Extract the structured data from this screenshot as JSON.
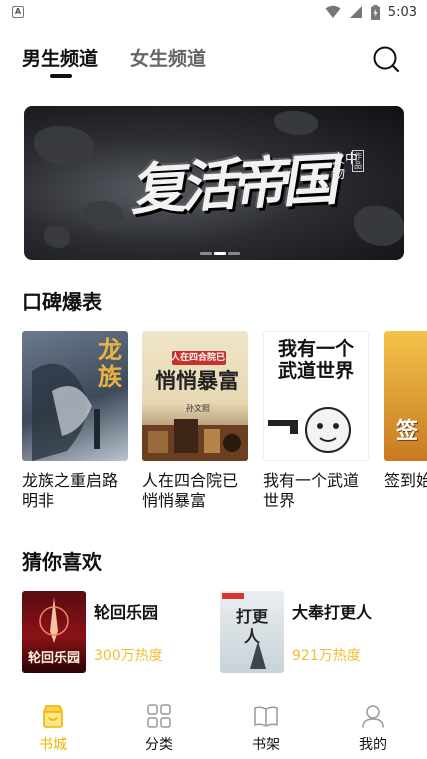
{
  "status_bar": {
    "time": "5:03",
    "app_icon_glyph": "A",
    "icons": [
      "wifi-icon",
      "signal-icon",
      "battery-icon"
    ]
  },
  "channels": {
    "male": "男生频道",
    "female": "女生频道",
    "active": "male"
  },
  "banner": {
    "title": "复活帝国",
    "author": "火中物",
    "author_note": "作品",
    "slides": 3,
    "active_slide": 1
  },
  "ranking": {
    "title": "口碑爆表",
    "books": [
      {
        "name": "龙族之重启路明非",
        "cover_text": "龙族"
      },
      {
        "name": "人在四合院已悄悄暴富",
        "cover_text_top": "人在四合院已",
        "cover_text": "悄悄暴富",
        "cover_author": "孙文照"
      },
      {
        "name": "我有一个武道世界",
        "cover_text": "我有一个武道世界"
      },
      {
        "name": "签到始",
        "cover_text": "签"
      }
    ]
  },
  "recommend": {
    "title": "猜你喜欢",
    "books": [
      {
        "title": "轮回乐园",
        "heat": "300万热度",
        "cover_text": "轮回乐园"
      },
      {
        "title": "大奉打更人",
        "heat": "921万热度",
        "cover_text": "打更人"
      }
    ]
  },
  "bottom_nav": [
    {
      "label": "书城",
      "icon": "bookstore-icon",
      "active": true
    },
    {
      "label": "分类",
      "icon": "grid-icon",
      "active": false
    },
    {
      "label": "书架",
      "icon": "book-open-icon",
      "active": false
    },
    {
      "label": "我的",
      "icon": "user-icon",
      "active": false
    }
  ],
  "colors": {
    "accent": "#f0b400",
    "heat": "#f0c033",
    "text": "#111111"
  }
}
